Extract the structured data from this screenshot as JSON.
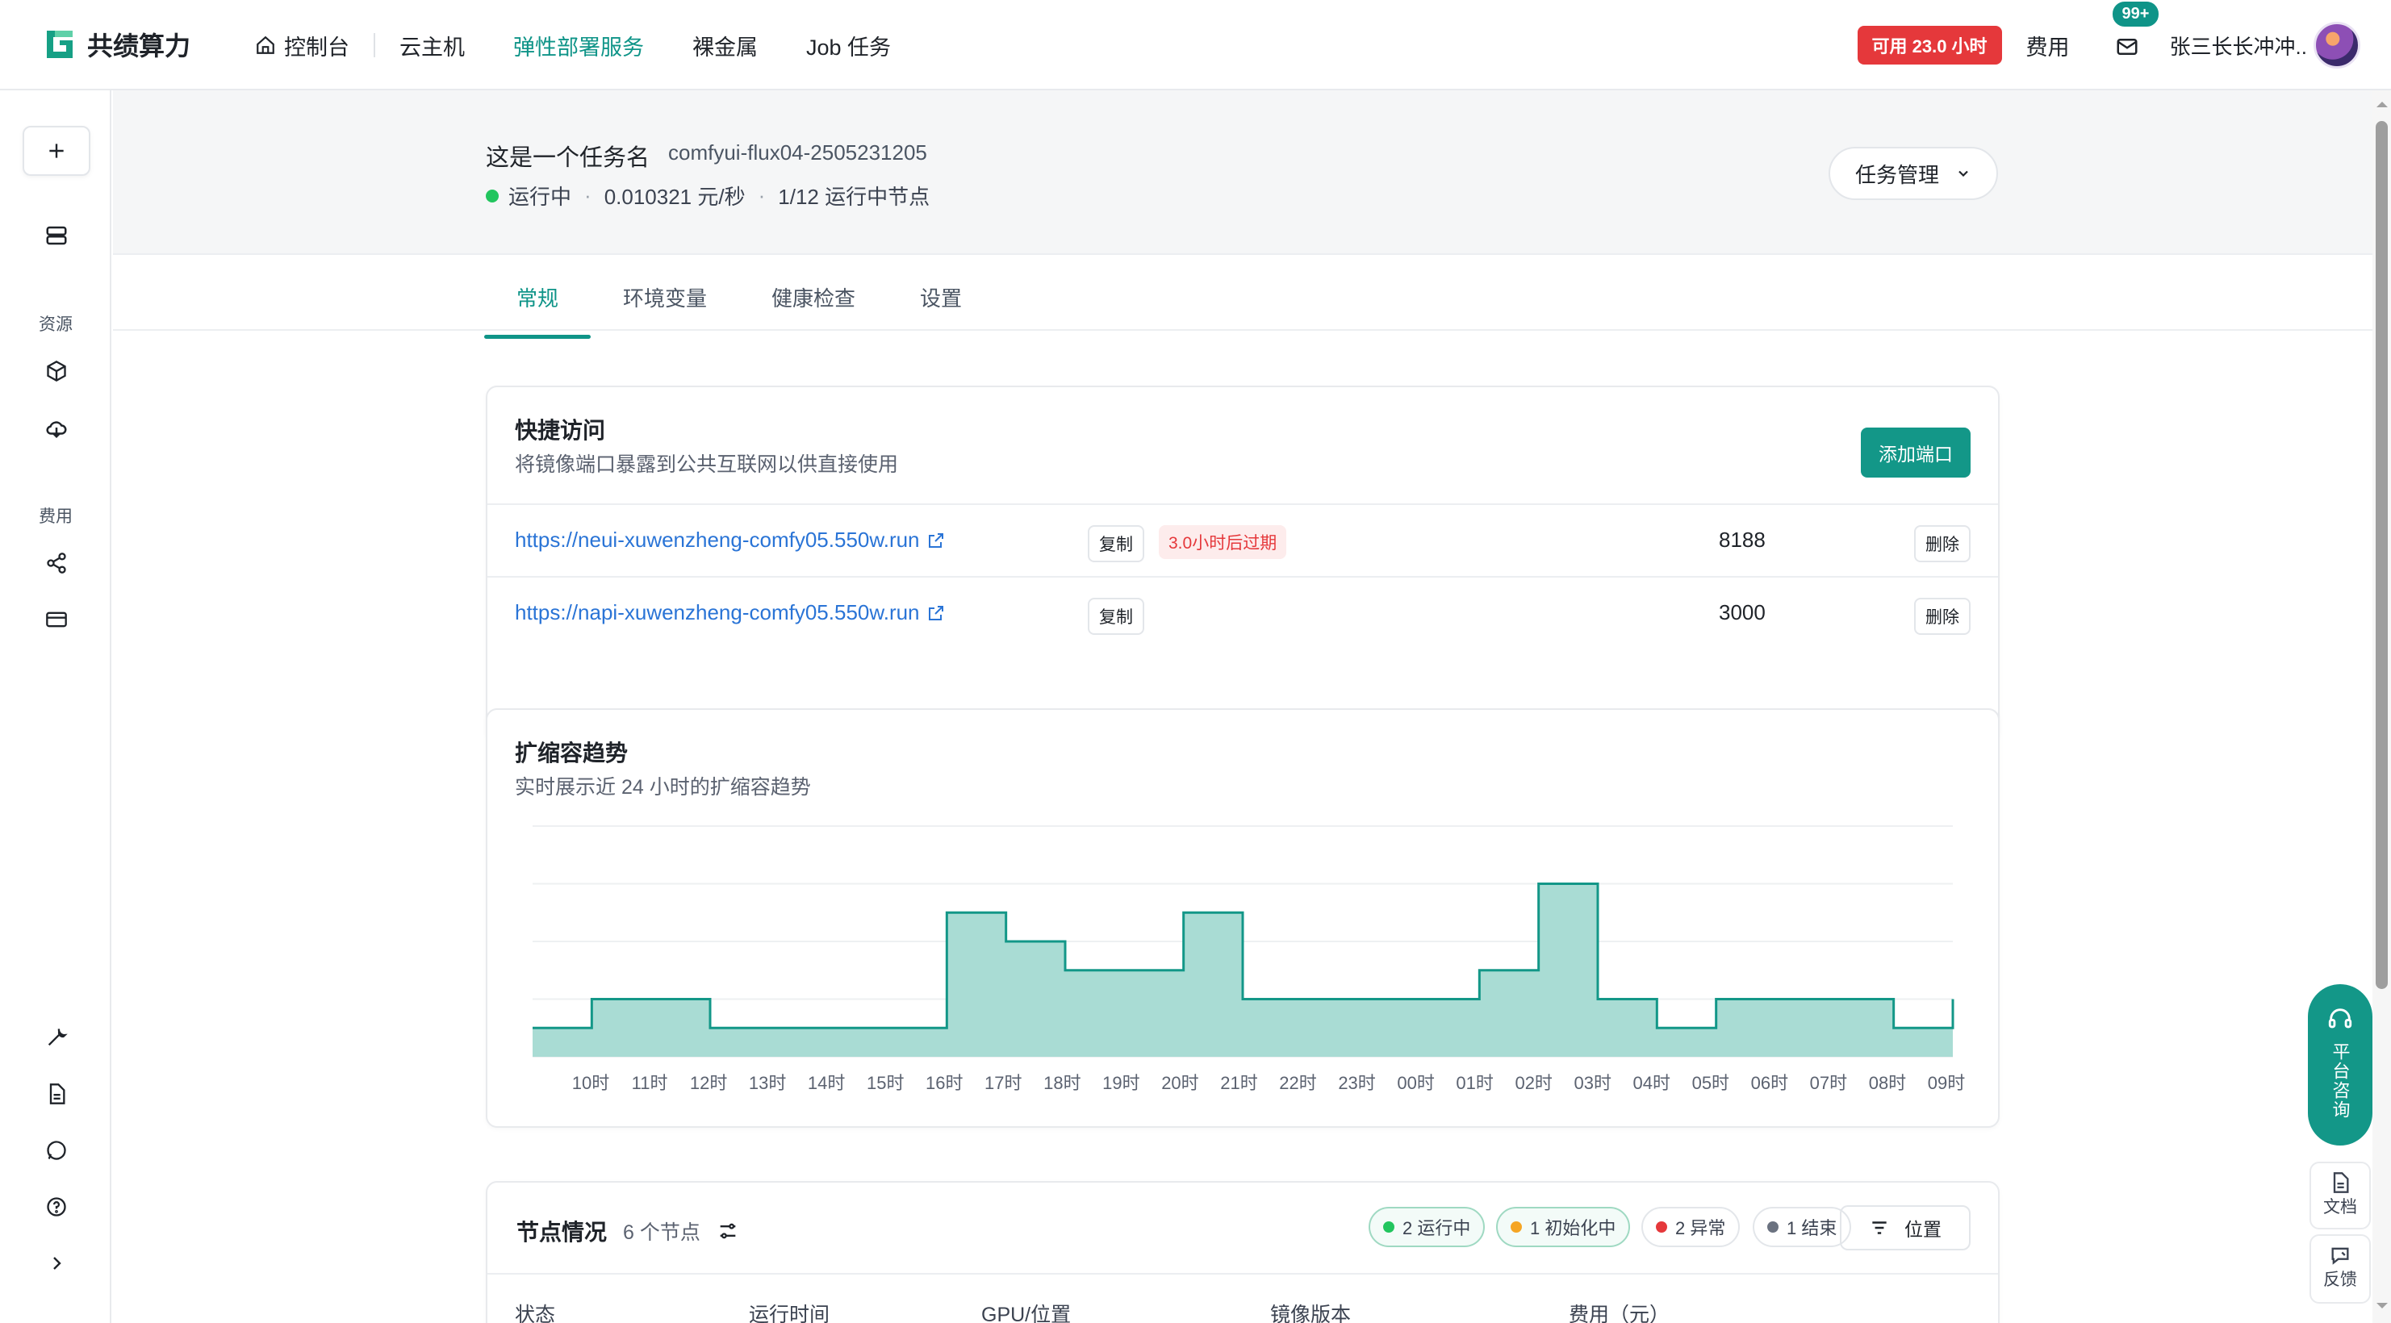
{
  "brand": {
    "name": "共绩算力",
    "color": "#0f9488"
  },
  "nav": {
    "items": [
      {
        "label": "控制台",
        "icon": "home-icon"
      },
      {
        "label": "云主机"
      },
      {
        "label": "弹性部署服务",
        "active": true
      },
      {
        "label": "裸金属"
      },
      {
        "label": "Job 任务"
      }
    ]
  },
  "top_right": {
    "available": "可用 23.0 小时",
    "fee": "费用",
    "mail_count": "99+",
    "username": "张三长长冲冲.."
  },
  "sidebar": {
    "resources_label": "资源",
    "fees_label": "费用"
  },
  "task": {
    "name": "这是一个任务名",
    "id": "comfyui-flux04-2505231205",
    "status": "运行中",
    "status_color": "#22c55e",
    "price": "0.010321 元/秒",
    "nodes": "1/12 运行中节点",
    "manage_label": "任务管理"
  },
  "tabs": [
    {
      "label": "常规",
      "active": true
    },
    {
      "label": "环境变量"
    },
    {
      "label": "健康检查"
    },
    {
      "label": "设置"
    }
  ],
  "quick_access": {
    "title": "快捷访问",
    "subtitle": "将镜像端口暴露到公共互联网以供直接使用",
    "add_label": "添加端口",
    "rows": [
      {
        "url": "https://neui-xuwenzheng-comfy05.550w.run",
        "copy": "复制",
        "expire": "3.0小时后过期",
        "port": "8188",
        "delete": "删除"
      },
      {
        "url": "https://napi-xuwenzheng-comfy05.550w.run",
        "copy": "复制",
        "port": "3000",
        "delete": "删除"
      }
    ]
  },
  "scaling": {
    "title": "扩缩容趋势",
    "subtitle": "实时展示近 24 小时的扩缩容趋势"
  },
  "chart_data": {
    "type": "area",
    "step": true,
    "categories": [
      "10时",
      "11时",
      "12时",
      "13时",
      "14时",
      "15时",
      "16时",
      "17时",
      "18时",
      "19时",
      "20时",
      "21时",
      "22时",
      "23时",
      "00时",
      "01时",
      "02时",
      "03时",
      "04时",
      "05时",
      "06时",
      "07时",
      "08时",
      "09时"
    ],
    "values": [
      1,
      2,
      2,
      1,
      1,
      1,
      1,
      5,
      4,
      3,
      3,
      5,
      2,
      2,
      2,
      2,
      3,
      6,
      2,
      1,
      2,
      2,
      2,
      1,
      2
    ],
    "ylim": [
      0,
      8
    ],
    "grid": true,
    "color": "#139788"
  },
  "nodes": {
    "title": "节点情况",
    "count": "6 个节点",
    "filters": [
      {
        "label": "2 运行中",
        "color": "#22c55e"
      },
      {
        "label": "1 初始化中",
        "color": "#f5a524"
      },
      {
        "label": "2 异常",
        "color": "#e5383b"
      },
      {
        "label": "1 结束",
        "color": "#6b7280"
      }
    ],
    "position_label": "位置",
    "columns": [
      "状态",
      "运行时间",
      "GPU/位置",
      "镜像版本",
      "费用（元）"
    ]
  },
  "helpers": {
    "consult": "平台咨询",
    "docs": "文档",
    "feedback": "反馈"
  }
}
